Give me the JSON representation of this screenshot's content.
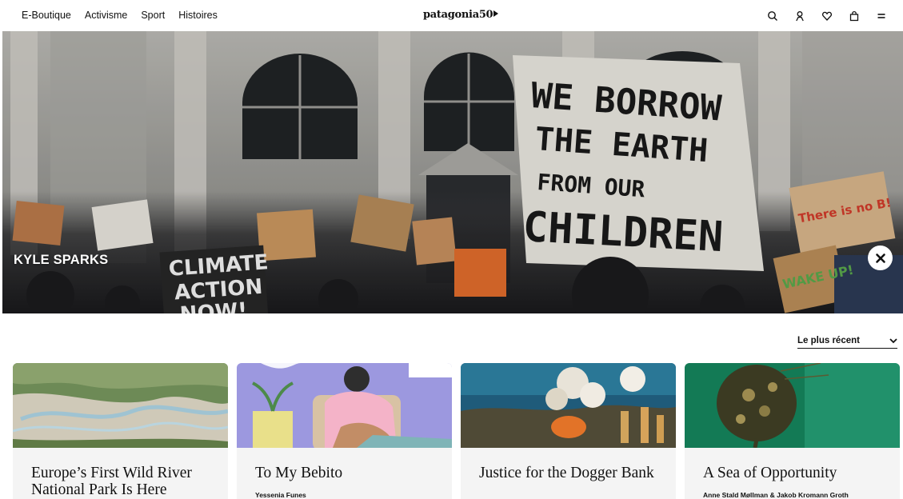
{
  "nav": {
    "items": [
      "E-Boutique",
      "Activisme",
      "Sport",
      "Histoires"
    ],
    "logo_text": "patagonia50"
  },
  "header_icons": [
    "search-icon",
    "account-icon",
    "wishlist-icon",
    "cart-icon",
    "menu-icon"
  ],
  "hero": {
    "title": "KYLE SPARKS",
    "sign_main": [
      "WE BORROW",
      "THE EARTH",
      "FROM OUR",
      "CHILDREN"
    ],
    "sign_left": [
      "CLIMATE",
      "ACTION",
      "NOW!"
    ],
    "sign_right_top": "There is no B!",
    "sign_right_bottom": "WAKE UP!"
  },
  "sort": {
    "selected": "Le plus récent"
  },
  "cards": [
    {
      "title": "Europe’s First Wild River National Park Is Here",
      "author": ""
    },
    {
      "title": "To My Bebito",
      "author": "Yessenia Funes"
    },
    {
      "title": "Justice for the Dogger Bank",
      "author": ""
    },
    {
      "title": "A Sea of Opportunity",
      "author": "Anne Stald Møllman & Jakob Kromann Groth"
    }
  ],
  "colors": {
    "text": "#111111",
    "card_bg": "#f4f4f4",
    "hero_overlay": "#5d6166"
  }
}
